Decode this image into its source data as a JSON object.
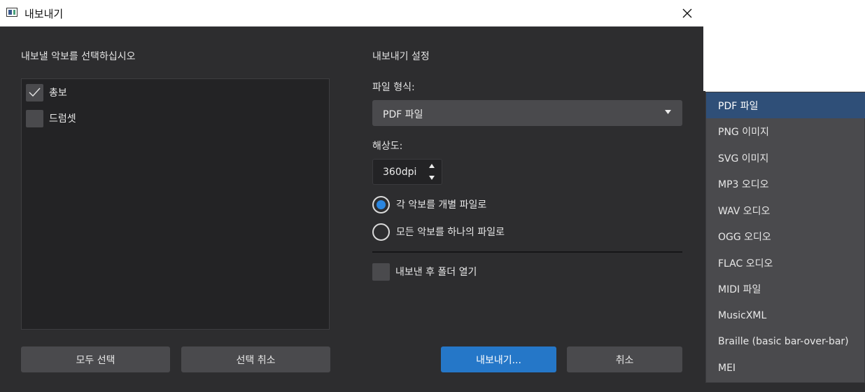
{
  "window": {
    "title": "내보내기",
    "close_icon": "close-icon"
  },
  "left_panel": {
    "heading": "내보낼 악보를 선택하십시오",
    "scores": [
      {
        "label": "총보",
        "checked": true
      },
      {
        "label": "드럼셋",
        "checked": false
      }
    ],
    "select_all_label": "모두 선택",
    "deselect_label": "선택 취소"
  },
  "settings": {
    "heading": "내보내기 설정",
    "format_label": "파일 형식:",
    "format_value": "PDF 파일",
    "resolution_label": "해상도:",
    "resolution_value": "360dpi",
    "radio_separate": "각 악보를 개별 파일로",
    "radio_single": "모든 악보를 하나의 파일로",
    "radio_selected": "separate",
    "open_folder_label": "내보낸 후 폴더 열기",
    "open_folder_checked": false
  },
  "buttons": {
    "export_label": "내보내기...",
    "cancel_label": "취소"
  },
  "format_dropdown": {
    "selected_index": 0,
    "options": [
      "PDF 파일",
      "PNG 이미지",
      "SVG 이미지",
      "MP3 오디오",
      "WAV 오디오",
      "OGG 오디오",
      "FLAC 오디오",
      "MIDI 파일",
      "MusicXML",
      "Braille (basic bar-over-bar)",
      "MEI"
    ]
  },
  "colors": {
    "accent": "#2577c8",
    "radio_dot": "#2a86e0",
    "dialog_bg": "#2d2d2f",
    "selected_option_bg": "#2f4f78"
  }
}
